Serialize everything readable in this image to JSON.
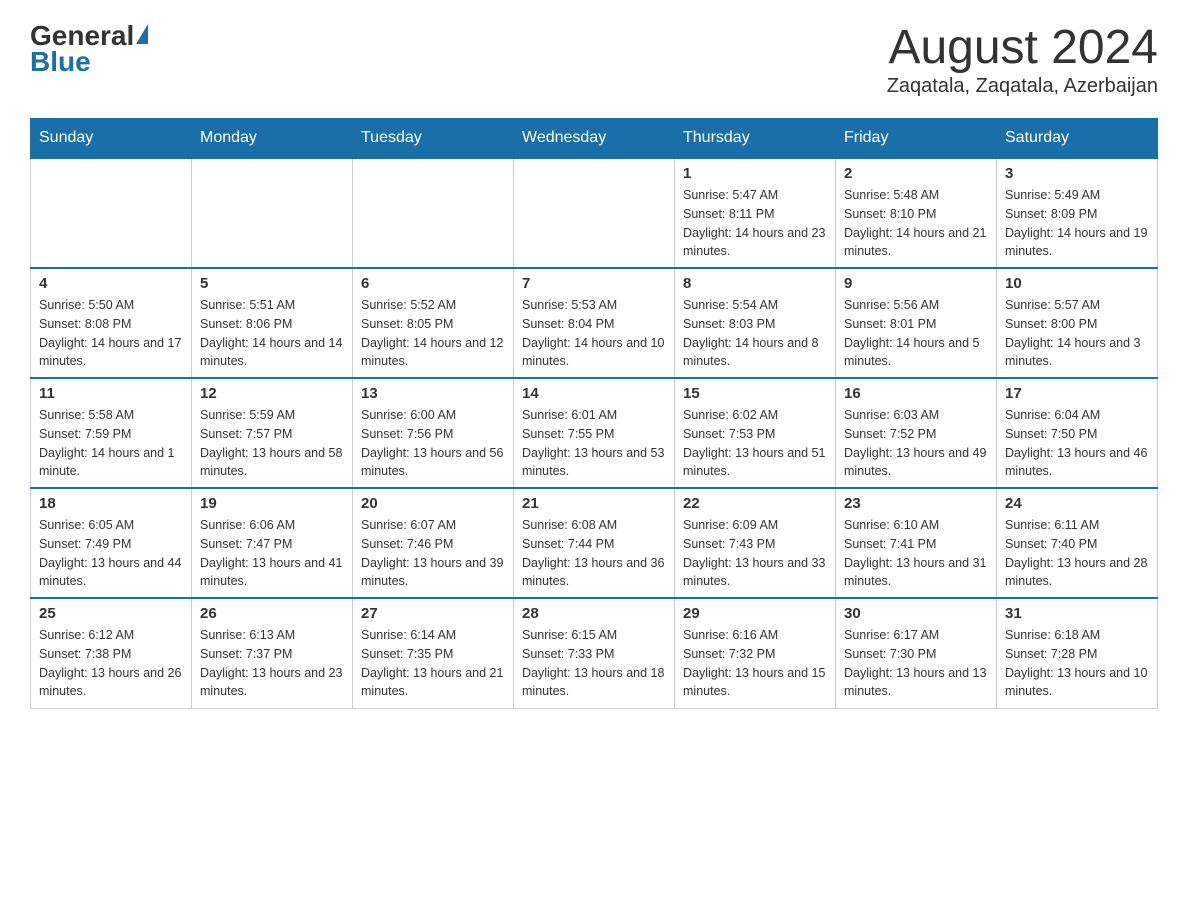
{
  "header": {
    "logo_general": "General",
    "logo_blue": "Blue",
    "month_title": "August 2024",
    "location": "Zaqatala, Zaqatala, Azerbaijan"
  },
  "weekdays": [
    "Sunday",
    "Monday",
    "Tuesday",
    "Wednesday",
    "Thursday",
    "Friday",
    "Saturday"
  ],
  "weeks": [
    [
      {
        "day": "",
        "info": ""
      },
      {
        "day": "",
        "info": ""
      },
      {
        "day": "",
        "info": ""
      },
      {
        "day": "",
        "info": ""
      },
      {
        "day": "1",
        "info": "Sunrise: 5:47 AM\nSunset: 8:11 PM\nDaylight: 14 hours and 23 minutes."
      },
      {
        "day": "2",
        "info": "Sunrise: 5:48 AM\nSunset: 8:10 PM\nDaylight: 14 hours and 21 minutes."
      },
      {
        "day": "3",
        "info": "Sunrise: 5:49 AM\nSunset: 8:09 PM\nDaylight: 14 hours and 19 minutes."
      }
    ],
    [
      {
        "day": "4",
        "info": "Sunrise: 5:50 AM\nSunset: 8:08 PM\nDaylight: 14 hours and 17 minutes."
      },
      {
        "day": "5",
        "info": "Sunrise: 5:51 AM\nSunset: 8:06 PM\nDaylight: 14 hours and 14 minutes."
      },
      {
        "day": "6",
        "info": "Sunrise: 5:52 AM\nSunset: 8:05 PM\nDaylight: 14 hours and 12 minutes."
      },
      {
        "day": "7",
        "info": "Sunrise: 5:53 AM\nSunset: 8:04 PM\nDaylight: 14 hours and 10 minutes."
      },
      {
        "day": "8",
        "info": "Sunrise: 5:54 AM\nSunset: 8:03 PM\nDaylight: 14 hours and 8 minutes."
      },
      {
        "day": "9",
        "info": "Sunrise: 5:56 AM\nSunset: 8:01 PM\nDaylight: 14 hours and 5 minutes."
      },
      {
        "day": "10",
        "info": "Sunrise: 5:57 AM\nSunset: 8:00 PM\nDaylight: 14 hours and 3 minutes."
      }
    ],
    [
      {
        "day": "11",
        "info": "Sunrise: 5:58 AM\nSunset: 7:59 PM\nDaylight: 14 hours and 1 minute."
      },
      {
        "day": "12",
        "info": "Sunrise: 5:59 AM\nSunset: 7:57 PM\nDaylight: 13 hours and 58 minutes."
      },
      {
        "day": "13",
        "info": "Sunrise: 6:00 AM\nSunset: 7:56 PM\nDaylight: 13 hours and 56 minutes."
      },
      {
        "day": "14",
        "info": "Sunrise: 6:01 AM\nSunset: 7:55 PM\nDaylight: 13 hours and 53 minutes."
      },
      {
        "day": "15",
        "info": "Sunrise: 6:02 AM\nSunset: 7:53 PM\nDaylight: 13 hours and 51 minutes."
      },
      {
        "day": "16",
        "info": "Sunrise: 6:03 AM\nSunset: 7:52 PM\nDaylight: 13 hours and 49 minutes."
      },
      {
        "day": "17",
        "info": "Sunrise: 6:04 AM\nSunset: 7:50 PM\nDaylight: 13 hours and 46 minutes."
      }
    ],
    [
      {
        "day": "18",
        "info": "Sunrise: 6:05 AM\nSunset: 7:49 PM\nDaylight: 13 hours and 44 minutes."
      },
      {
        "day": "19",
        "info": "Sunrise: 6:06 AM\nSunset: 7:47 PM\nDaylight: 13 hours and 41 minutes."
      },
      {
        "day": "20",
        "info": "Sunrise: 6:07 AM\nSunset: 7:46 PM\nDaylight: 13 hours and 39 minutes."
      },
      {
        "day": "21",
        "info": "Sunrise: 6:08 AM\nSunset: 7:44 PM\nDaylight: 13 hours and 36 minutes."
      },
      {
        "day": "22",
        "info": "Sunrise: 6:09 AM\nSunset: 7:43 PM\nDaylight: 13 hours and 33 minutes."
      },
      {
        "day": "23",
        "info": "Sunrise: 6:10 AM\nSunset: 7:41 PM\nDaylight: 13 hours and 31 minutes."
      },
      {
        "day": "24",
        "info": "Sunrise: 6:11 AM\nSunset: 7:40 PM\nDaylight: 13 hours and 28 minutes."
      }
    ],
    [
      {
        "day": "25",
        "info": "Sunrise: 6:12 AM\nSunset: 7:38 PM\nDaylight: 13 hours and 26 minutes."
      },
      {
        "day": "26",
        "info": "Sunrise: 6:13 AM\nSunset: 7:37 PM\nDaylight: 13 hours and 23 minutes."
      },
      {
        "day": "27",
        "info": "Sunrise: 6:14 AM\nSunset: 7:35 PM\nDaylight: 13 hours and 21 minutes."
      },
      {
        "day": "28",
        "info": "Sunrise: 6:15 AM\nSunset: 7:33 PM\nDaylight: 13 hours and 18 minutes."
      },
      {
        "day": "29",
        "info": "Sunrise: 6:16 AM\nSunset: 7:32 PM\nDaylight: 13 hours and 15 minutes."
      },
      {
        "day": "30",
        "info": "Sunrise: 6:17 AM\nSunset: 7:30 PM\nDaylight: 13 hours and 13 minutes."
      },
      {
        "day": "31",
        "info": "Sunrise: 6:18 AM\nSunset: 7:28 PM\nDaylight: 13 hours and 10 minutes."
      }
    ]
  ]
}
